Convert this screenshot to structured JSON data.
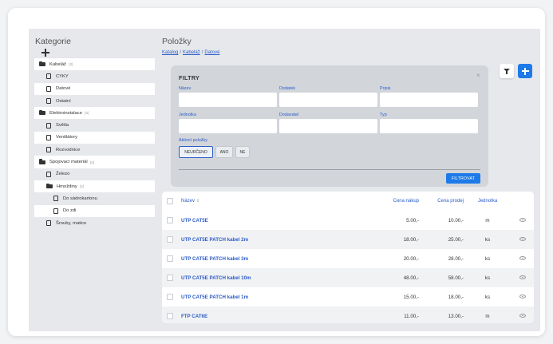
{
  "sidebar": {
    "title": "Kategorie",
    "items": [
      {
        "label": "Kabeláž",
        "count": "(3)",
        "type": "folder",
        "indent": 0,
        "bg": "white"
      },
      {
        "label": "CYKY",
        "count": "",
        "type": "file",
        "indent": 1,
        "bg": "gray"
      },
      {
        "label": "Datové",
        "count": "",
        "type": "file",
        "indent": 1,
        "bg": "white"
      },
      {
        "label": "Ostatní",
        "count": "",
        "type": "file",
        "indent": 1,
        "bg": "gray"
      },
      {
        "label": "Elektroinstalace",
        "count": "(3)",
        "type": "folder",
        "indent": 0,
        "bg": "white"
      },
      {
        "label": "Světla",
        "count": "",
        "type": "file",
        "indent": 1,
        "bg": "gray"
      },
      {
        "label": "Ventilátory",
        "count": "",
        "type": "file",
        "indent": 1,
        "bg": "white"
      },
      {
        "label": "Rozvodnice",
        "count": "",
        "type": "file",
        "indent": 1,
        "bg": "gray"
      },
      {
        "label": "Spojovací materiál",
        "count": "(3)",
        "type": "folder",
        "indent": 0,
        "bg": "white"
      },
      {
        "label": "Železo",
        "count": "",
        "type": "file",
        "indent": 1,
        "bg": "gray"
      },
      {
        "label": "Hmoždiny",
        "count": "(2)",
        "type": "folder",
        "indent": 1,
        "bg": "white"
      },
      {
        "label": "Do sádrokartonu",
        "count": "",
        "type": "file",
        "indent": 2,
        "bg": "gray"
      },
      {
        "label": "Do zdi",
        "count": "",
        "type": "file",
        "indent": 2,
        "bg": "white"
      },
      {
        "label": "Šrouby, matice",
        "count": "",
        "type": "file",
        "indent": 1,
        "bg": "gray"
      }
    ]
  },
  "main": {
    "title": "Položky",
    "breadcrumb": [
      "Katalog",
      "Kabeláž",
      "Datové"
    ],
    "breadcrumb_sep": "/"
  },
  "filters": {
    "title": "FILTRY",
    "close_label": "×",
    "fields": {
      "nazev": {
        "label": "Název",
        "value": ""
      },
      "dodatek": {
        "label": "Dodatek",
        "value": ""
      },
      "popis": {
        "label": "Popis",
        "value": ""
      },
      "jednotka": {
        "label": "Jednotka",
        "value": ""
      },
      "dodavatel": {
        "label": "Dodavatel",
        "value": ""
      },
      "typ": {
        "label": "Typ",
        "value": ""
      }
    },
    "aktivni_label": "Aktivní položky",
    "aktivni_options": [
      "NEURČENO",
      "ANO",
      "NE"
    ],
    "aktivni_selected": "NEURČENO",
    "submit_label": "FILTROVAT"
  },
  "table": {
    "columns": {
      "name": "Název",
      "nakup": "Cena nákup",
      "prodej": "Cena prodej",
      "unit": "Jednotka"
    },
    "sort_indicator": "⇕",
    "rows": [
      {
        "name": "UTP CAT5E",
        "nakup": "5.00,-",
        "prodej": "10.00,-",
        "unit": "m"
      },
      {
        "name": "UTP CAT5E PATCH kabel 2m",
        "nakup": "18.00,-",
        "prodej": "25.00,-",
        "unit": "ks"
      },
      {
        "name": "UTP CAT5E PATCH kabel 3m",
        "nakup": "20.00,-",
        "prodej": "28.00,-",
        "unit": "ks"
      },
      {
        "name": "UTP CAT5E PATCH kabel 10m",
        "nakup": "48.00,-",
        "prodej": "58.00,-",
        "unit": "ks"
      },
      {
        "name": "UTP CAT5E PATCH kabel 1m",
        "nakup": "15.00,-",
        "prodej": "18.00,-",
        "unit": "ks"
      },
      {
        "name": "FTP CAT6E",
        "nakup": "11.00,-",
        "prodej": "13.00,-",
        "unit": "m"
      }
    ]
  },
  "colors": {
    "accent": "#1e7ae8",
    "link": "#2c5cc8",
    "panel_bg": "#d2d6db",
    "page_bg": "#e6e8eb"
  }
}
